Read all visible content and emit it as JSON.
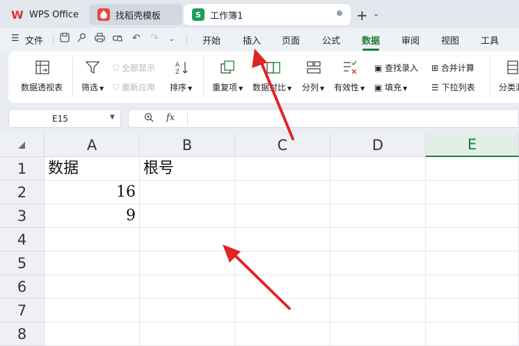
{
  "tabs": [
    {
      "label": "WPS Office",
      "icon": "wps-logo-icon"
    },
    {
      "label": "找稻壳模板",
      "icon": "docer-logo-icon"
    },
    {
      "label": "工作簿1",
      "icon": "sheet-logo-icon",
      "logo_letter": "S"
    }
  ],
  "menubar": {
    "file_label": "文件",
    "items": [
      "开始",
      "插入",
      "页面",
      "公式",
      "数据",
      "审阅",
      "视图",
      "工具"
    ],
    "active": "数据"
  },
  "ribbon": {
    "pivot_table": "数据透视表",
    "filter": "筛选",
    "show_all": "全部显示",
    "reapply": "重新应用",
    "sort": "排序",
    "duplicates": "重复项",
    "compare": "数据对比",
    "split": "分列",
    "validity": "有效性",
    "find_entry": "查找录入",
    "fill": "填充",
    "consolidate": "合并计算",
    "dropdown_list": "下拉列表",
    "subtotal": "分类汇"
  },
  "formula_bar": {
    "cell_ref": "E15",
    "fx_label": "fx",
    "content": ""
  },
  "sheet": {
    "columns": [
      "A",
      "B",
      "C",
      "D",
      "E"
    ],
    "selected_column": "E",
    "rows": [
      "1",
      "2",
      "3",
      "4",
      "5",
      "6",
      "7",
      "8"
    ],
    "cells": {
      "A1": "数据",
      "B1": "根号",
      "A2": "16",
      "A3": "9"
    }
  },
  "colors": {
    "accent": "#1a7f3c",
    "arrow": "#e02424"
  }
}
